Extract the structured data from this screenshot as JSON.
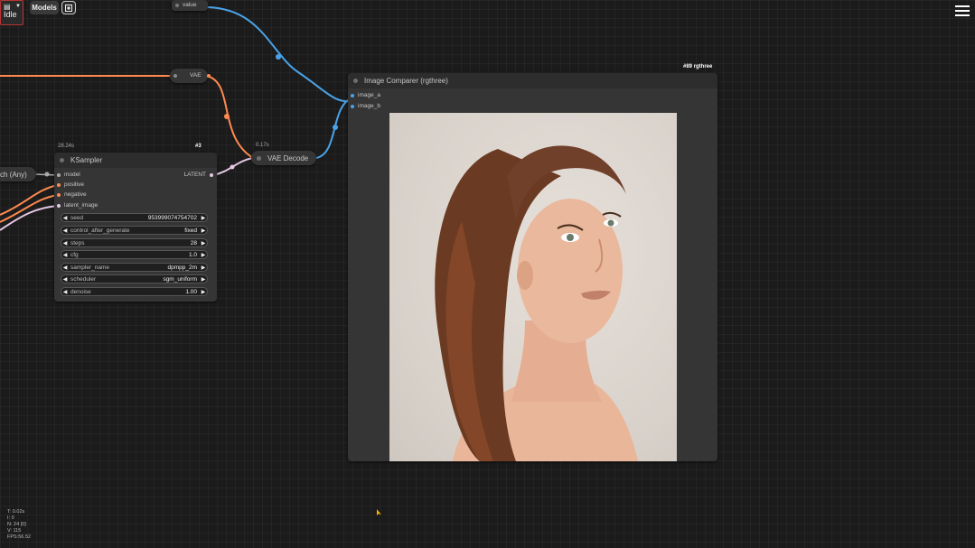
{
  "topbar": {
    "status_label": "Idle",
    "models_label": "Models",
    "queue_icon": "queue-icon",
    "menu_icon": "hamburger-icon"
  },
  "nodes": {
    "value_node": {
      "label": "value"
    },
    "vae_node": {
      "label": "VAE"
    },
    "switch_node": {
      "label": "ch (Any)"
    },
    "ksampler": {
      "time": "28.24s",
      "id_badge": "#3",
      "title": "KSampler",
      "inputs": [
        "model",
        "positive",
        "negative",
        "latent_image"
      ],
      "output": "LATENT",
      "widgets": [
        {
          "label": "seed",
          "value": "953999074754702"
        },
        {
          "label": "control_after_generate",
          "value": "fixed"
        },
        {
          "label": "steps",
          "value": "28"
        },
        {
          "label": "cfg",
          "value": "1.0"
        },
        {
          "label": "sampler_name",
          "value": "dpmpp_2m"
        },
        {
          "label": "scheduler",
          "value": "sgm_uniform"
        },
        {
          "label": "denoise",
          "value": "1.00"
        }
      ]
    },
    "vae_decode": {
      "time": "0.17s",
      "title": "VAE Decode"
    },
    "image_comparer": {
      "id_badge": "#89 rgthree",
      "title": "Image Comparer (rgthree)",
      "inputs": [
        "image_a",
        "image_b"
      ]
    }
  },
  "stats": {
    "lines": [
      "T: 0.02s",
      "I: 0",
      "N: 24 [0]",
      "V: 115",
      "FPS:56.52"
    ]
  },
  "colors": {
    "model_link": "#4aa3e8",
    "vae_link": "#ff8a50",
    "latent_link": "#ff9cf9",
    "canvas": "#1b1b1b",
    "node_body": "#353535"
  }
}
